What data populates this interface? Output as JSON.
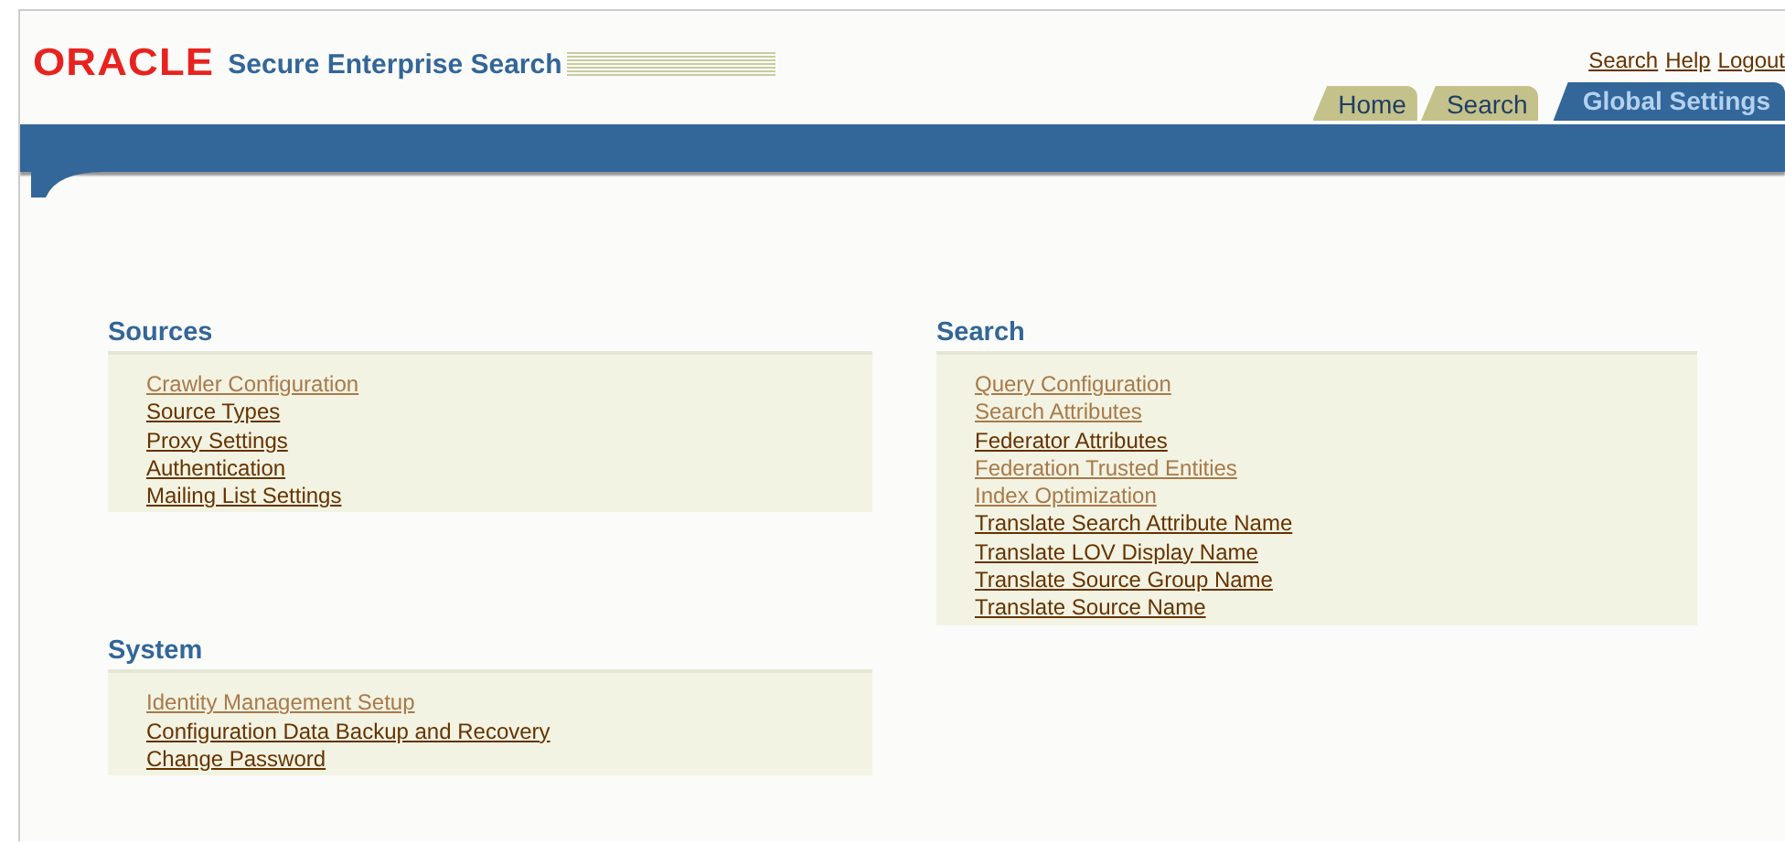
{
  "header": {
    "logo": "ORACLE",
    "product": "Secure Enterprise Search"
  },
  "global_links": [
    "Search",
    "Help",
    "Logout"
  ],
  "tabs": [
    {
      "label": "Home",
      "selected": false
    },
    {
      "label": "Search",
      "selected": false
    },
    {
      "label": "Global Settings",
      "selected": true
    }
  ],
  "sections": [
    {
      "title": "Sources",
      "links": [
        {
          "label": "Crawler Configuration",
          "visited": true
        },
        {
          "label": "Source Types",
          "visited": false
        },
        {
          "label": "Proxy Settings",
          "visited": false
        },
        {
          "label": "Authentication",
          "visited": false
        },
        {
          "label": "Mailing List Settings",
          "visited": false
        }
      ]
    },
    {
      "title": "Search",
      "links": [
        {
          "label": "Query Configuration",
          "visited": true
        },
        {
          "label": "Search Attributes",
          "visited": true
        },
        {
          "label": "Federator Attributes",
          "visited": false
        },
        {
          "label": "Federation Trusted Entities",
          "visited": true
        },
        {
          "label": "Index Optimization",
          "visited": true
        },
        {
          "label": "Translate Search Attribute Name",
          "visited": false
        },
        {
          "label": "Translate LOV Display Name",
          "visited": false
        },
        {
          "label": "Translate Source Group Name",
          "visited": false
        },
        {
          "label": "Translate Source Name",
          "visited": false
        }
      ]
    },
    {
      "title": "System",
      "links": [
        {
          "label": "Identity Management Setup",
          "visited": true
        },
        {
          "label": "Configuration Data Backup and Recovery",
          "visited": false
        },
        {
          "label": "Change Password",
          "visited": false
        }
      ]
    }
  ]
}
